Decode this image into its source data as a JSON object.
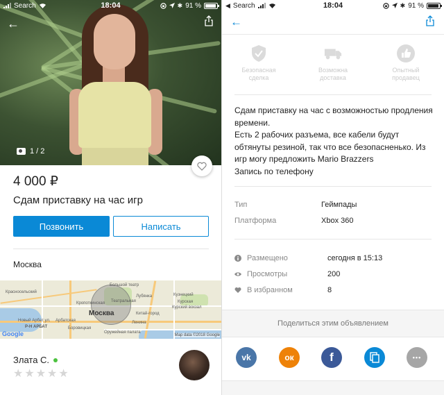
{
  "status_bar": {
    "carrier": "Search",
    "time": "18:04",
    "battery": "91 %"
  },
  "left": {
    "photo": {
      "counter": "1 / 2"
    },
    "price": "4 000 ₽",
    "title": "Сдам приставку на час игр",
    "buttons": {
      "call": "Позвонить",
      "write": "Написать"
    },
    "city": "Москва",
    "map": {
      "center_label": "Москва",
      "labels": [
        "Большой театр",
        "Красносельский",
        "Кропоткинская",
        "Лубянка",
        "Театральная",
        "Кузнецкий",
        "Курская",
        "Курский вокзал",
        "Новый Арбат ул.",
        "Арбатская",
        "Китай-город",
        "Ленина",
        "Р-Н АРБАТ",
        "Боровицкая",
        "Оружейная палата"
      ],
      "attribution": "Map data ©2018 Google",
      "logo": "Google"
    },
    "seller": {
      "name": "Злата С.",
      "rating_stars": 0,
      "rating_max": 5
    }
  },
  "right": {
    "features": [
      {
        "label": "Безопасная сделка",
        "icon": "shield-check-icon"
      },
      {
        "label": "Возможна доставка",
        "icon": "truck-icon"
      },
      {
        "label": "Опытный продавец",
        "icon": "thumbs-up-icon"
      }
    ],
    "description": [
      "Сдам приставку на час с возможностью продления времени.",
      "Есть 2 рабочих разъема, все кабели будут обтянуты резиной, так что все безопасненько. Из игр могу предложить Mario Brazzers",
      "Запись по телефону"
    ],
    "properties": [
      {
        "key": "Тип",
        "value": "Геймпады"
      },
      {
        "key": "Платформа",
        "value": "Xbox 360"
      }
    ],
    "stats": [
      {
        "key": "Размещено",
        "value": "сегодня в 15:13",
        "icon": "info-icon"
      },
      {
        "key": "Просмотры",
        "value": "200",
        "icon": "eye-icon"
      },
      {
        "key": "В избранном",
        "value": "8",
        "icon": "heart-icon"
      }
    ],
    "share_label": "Поделиться этим объявлением",
    "socials": [
      {
        "name": "vk",
        "text": "vk",
        "color": "#4a76a8"
      },
      {
        "name": "odnoklassniki",
        "text": "ок",
        "color": "#ee8208"
      },
      {
        "name": "facebook",
        "text": "f",
        "color": "#3b5998"
      },
      {
        "name": "copy",
        "text": "",
        "color": "#0a89d6"
      },
      {
        "name": "more",
        "text": "•••",
        "color": "#a6a6a6"
      }
    ]
  },
  "colors": {
    "accent": "#0a89d6",
    "online": "#4cc23f"
  }
}
